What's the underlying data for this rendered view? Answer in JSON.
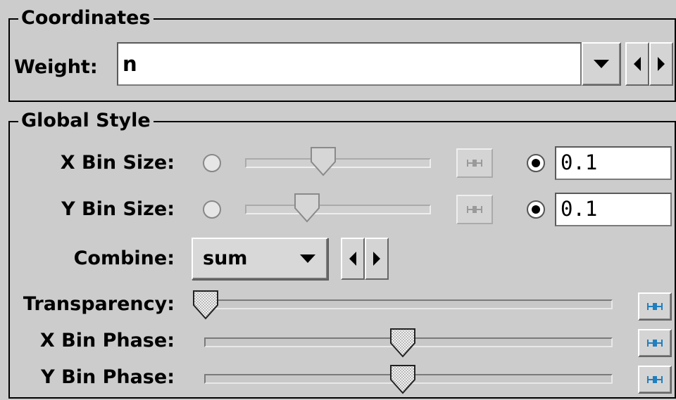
{
  "coordinates": {
    "title": "Coordinates",
    "weight_label": "Weight:",
    "weight_value": "n"
  },
  "global_style": {
    "title": "Global Style",
    "x_bin_size": {
      "label": "X Bin Size:",
      "value": "0.1",
      "slider_fraction": 0.44,
      "mode": "text"
    },
    "y_bin_size": {
      "label": "Y Bin Size:",
      "value": "0.1",
      "slider_fraction": 0.34,
      "mode": "text"
    },
    "combine": {
      "label": "Combine:",
      "value": "sum"
    },
    "transparency": {
      "label": "Transparency:",
      "slider_fraction": 0.0
    },
    "x_bin_phase": {
      "label": "X Bin Phase:",
      "slider_fraction": 0.5
    },
    "y_bin_phase": {
      "label": "Y Bin Phase:",
      "slider_fraction": 0.5
    }
  },
  "icons": {
    "dropdown": "chevron-down-icon",
    "prev": "arrow-left-icon",
    "next": "arrow-right-icon",
    "reset": "reset-slider-icon"
  },
  "colors": {
    "panel_bg": "#cccccc",
    "reset_icon": "#1f7fbf",
    "reset_icon_disabled": "#9a9a9a"
  }
}
